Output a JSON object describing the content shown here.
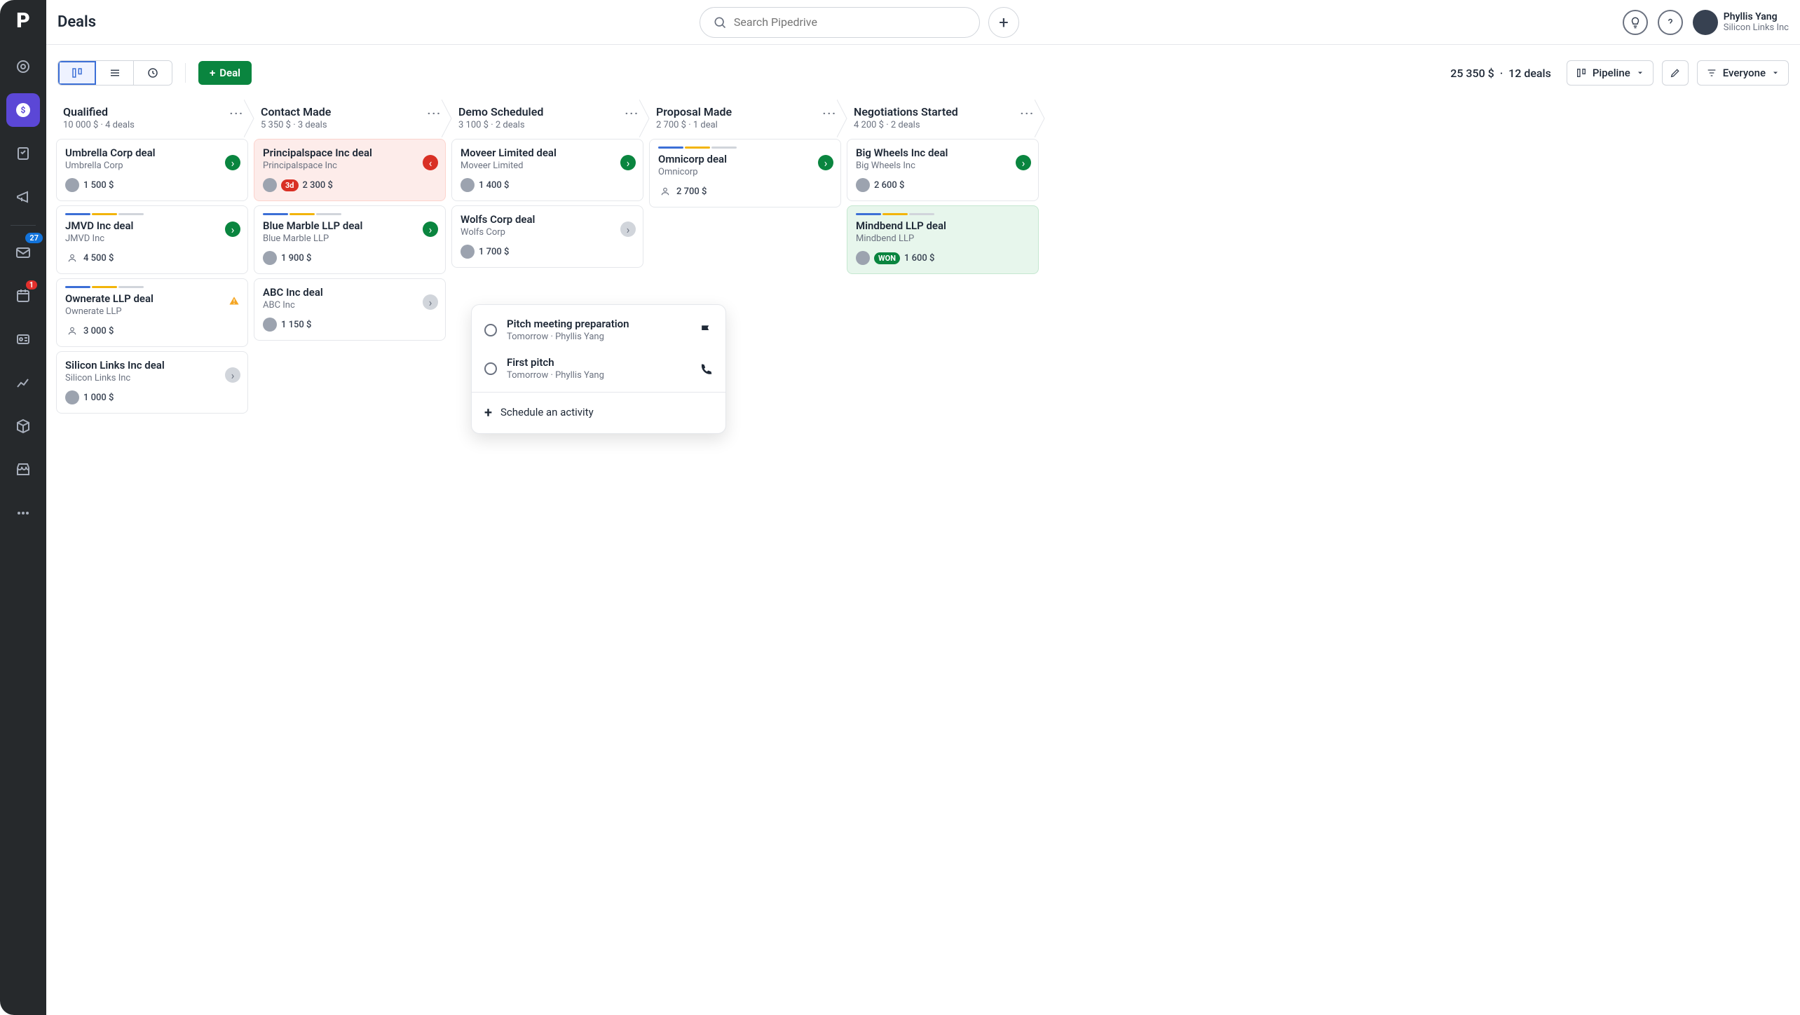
{
  "header": {
    "page_title": "Deals",
    "search_placeholder": "Search Pipedrive",
    "user_name": "Phyllis Yang",
    "user_org": "Silicon Links Inc"
  },
  "sidebar": {
    "mail_badge": "27",
    "calendar_badge": "1"
  },
  "toolbar": {
    "add_deal_label": "Deal",
    "summary_amount": "25 350 $",
    "summary_count": "12 deals",
    "pipeline_label": "Pipeline",
    "scope_label": "Everyone"
  },
  "columns": [
    {
      "title": "Qualified",
      "summary": "10 000 $ · 4 deals",
      "cards": [
        {
          "title": "Umbrella Corp deal",
          "org": "Umbrella Corp",
          "value": "1 500 $",
          "status": "green",
          "avatar": true
        },
        {
          "title": "JMVD Inc deal",
          "org": "JMVD Inc",
          "value": "4 500 $",
          "status": "green",
          "person": true,
          "stripes": true
        },
        {
          "title": "Ownerate LLP deal",
          "org": "Ownerate LLP",
          "value": "3 000 $",
          "warn": true,
          "person": true,
          "stripes": true
        },
        {
          "title": "Silicon Links Inc deal",
          "org": "Silicon Links Inc",
          "value": "1 000 $",
          "status": "gray",
          "avatar": true
        }
      ]
    },
    {
      "title": "Contact Made",
      "summary": "5 350 $ · 3 deals",
      "cards": [
        {
          "title": "Principalspace Inc deal",
          "org": "Principalspace Inc",
          "value": "2 300 $",
          "status": "red",
          "overdue": true,
          "pill": "3d",
          "avatar": true
        },
        {
          "title": "Blue Marble LLP deal",
          "org": "Blue Marble LLP",
          "value": "1 900 $",
          "status": "green",
          "avatar": true,
          "stripes": true
        },
        {
          "title": "ABC Inc deal",
          "org": "ABC Inc",
          "value": "1 150 $",
          "status": "gray",
          "avatar": true
        }
      ]
    },
    {
      "title": "Demo Scheduled",
      "summary": "3 100 $ · 2 deals",
      "cards": [
        {
          "title": "Moveer Limited deal",
          "org": "Moveer Limited",
          "value": "1 400 $",
          "status": "green",
          "avatar": true
        },
        {
          "title": "Wolfs Corp deal",
          "org": "Wolfs Corp",
          "value": "1 700 $",
          "status": "gray",
          "avatar": true
        }
      ]
    },
    {
      "title": "Proposal Made",
      "summary": "2 700 $ · 1 deal",
      "cards": [
        {
          "title": "Omnicorp deal",
          "org": "Omnicorp",
          "value": "2 700 $",
          "status": "green",
          "person": true,
          "stripes": true
        }
      ]
    },
    {
      "title": "Negotiations Started",
      "summary": "4 200 $ · 2 deals",
      "cards": [
        {
          "title": "Big Wheels Inc deal",
          "org": "Big Wheels Inc",
          "value": "2 600 $",
          "status": "green",
          "avatar": true
        },
        {
          "title": "Mindbend LLP deal",
          "org": "Mindbend LLP",
          "value": "1 600 $",
          "won": true,
          "won_pill": "WON",
          "avatar": true,
          "stripes": true
        }
      ]
    }
  ],
  "popover": {
    "items": [
      {
        "title": "Pitch meeting preparation",
        "sub": "Tomorrow · Phyllis Yang",
        "icon": "flag"
      },
      {
        "title": "First pitch",
        "sub": "Tomorrow · Phyllis Yang",
        "icon": "phone"
      }
    ],
    "action": "Schedule an activity"
  }
}
